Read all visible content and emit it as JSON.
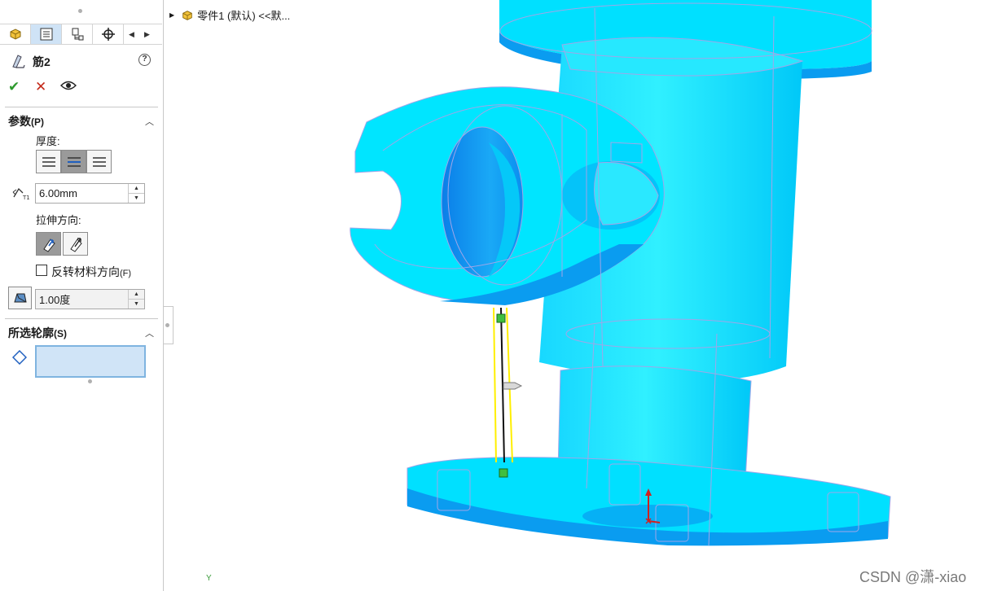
{
  "property_manager": {
    "tabs": [
      {
        "name": "feature-manager",
        "icon": "part-cube-icon",
        "active": false
      },
      {
        "name": "property-manager",
        "icon": "property-list-icon",
        "active": true
      },
      {
        "name": "configuration-manager",
        "icon": "configuration-icon",
        "active": false
      },
      {
        "name": "dimxpert-manager",
        "icon": "crosshair-icon",
        "active": false
      }
    ],
    "feature_title": "筋2",
    "help_label": "?",
    "ok_symbol": "✔",
    "cancel_symbol": "✕",
    "parameters": {
      "title": "参数",
      "shortcut": "(P)",
      "thickness_label": "厚度:",
      "thickness_value": "6.00mm",
      "extrusion_direction_label": "拉伸方向:",
      "flip_material_label": "反转材料方向",
      "flip_material_shortcut": "(F)",
      "flip_material_checked": false,
      "draft_value": "1.00度"
    },
    "selected_contours": {
      "title": "所选轮廓",
      "shortcut": "(S)"
    }
  },
  "viewport": {
    "tree_root_label": "零件1 (默认) <<默...",
    "axis_label": "Y",
    "watermark": "CSDN @潇-xiao",
    "colors": {
      "model_fill": "#00e5ff",
      "model_shade": "#0a9cf0",
      "edge_lines": "#a0a6e8",
      "rib_sketch": "#ffef00",
      "selection_box": "#d0e4f7"
    }
  }
}
